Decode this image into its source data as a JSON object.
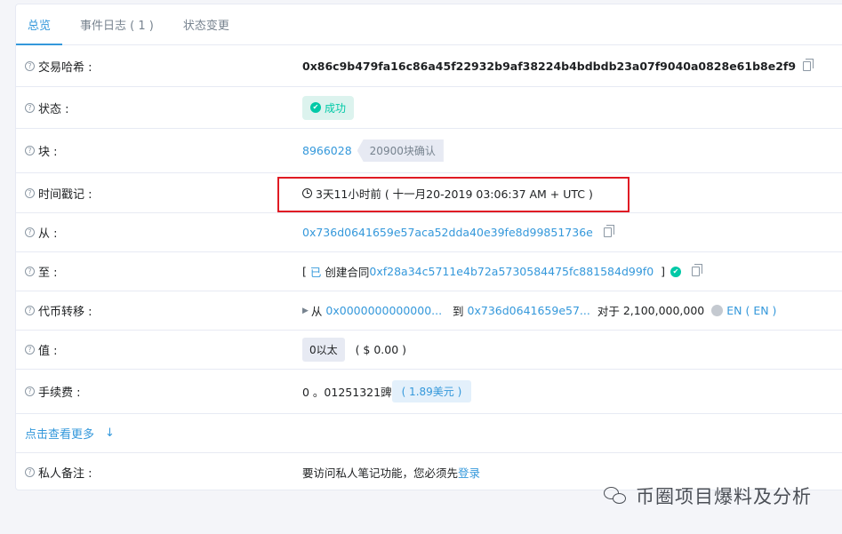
{
  "tabs": [
    {
      "label": "总览"
    },
    {
      "label": "事件日志 ( 1 )"
    },
    {
      "label": "状态变更"
    }
  ],
  "rows": {
    "tx_hash": {
      "label": "交易哈希 :",
      "value": "0x86c9b479fa16c86a45f22932b9af38224b4bdbdb23a07f9040a0828e61b8e2f9"
    },
    "status": {
      "label": "状态 :",
      "value": "成功"
    },
    "block": {
      "label": "块 :",
      "number": "8966028",
      "confirmations": "20900块确认"
    },
    "timestamp": {
      "label": "时间戳记 :",
      "value": "3天11小时前 ( 十一月20-2019 03:06:37 AM + UTC )"
    },
    "from": {
      "label": "从 :",
      "value": "0x736d0641659e57aca52dda40e39fe8d99851736e"
    },
    "to": {
      "label": "至 :",
      "prefix": "[",
      "created": "已",
      "created_text": "创建合同",
      "contract": "0xf28a34c5711e4b72a5730584475fc881584d99f0",
      "suffix": "]"
    },
    "token_transfer": {
      "label": "代币转移 :",
      "from_word": "从",
      "from_addr": "0x0000000000000...",
      "to_word": "到",
      "to_addr": "0x736d0641659e57...",
      "for_word": "对于",
      "amount": "2,100,000,000",
      "token": "EN ( EN )"
    },
    "value": {
      "label": "值 :",
      "amount": "0以太",
      "usd": "( $ 0.00 )"
    },
    "fee": {
      "label": "手续费 :",
      "amount": "0 。01251321豍",
      "usd": "( 1.89美元 )"
    },
    "more": {
      "label": "点击查看更多"
    },
    "note": {
      "label": "私人备注 :",
      "text": "要访问私人笔记功能，您必须先",
      "login": "登录"
    }
  },
  "help_glyph": "?",
  "watermark": "币圈项目爆料及分析",
  "colors": {
    "link": "#3498db",
    "success": "#00c9a7",
    "highlight": "#e01b24"
  }
}
